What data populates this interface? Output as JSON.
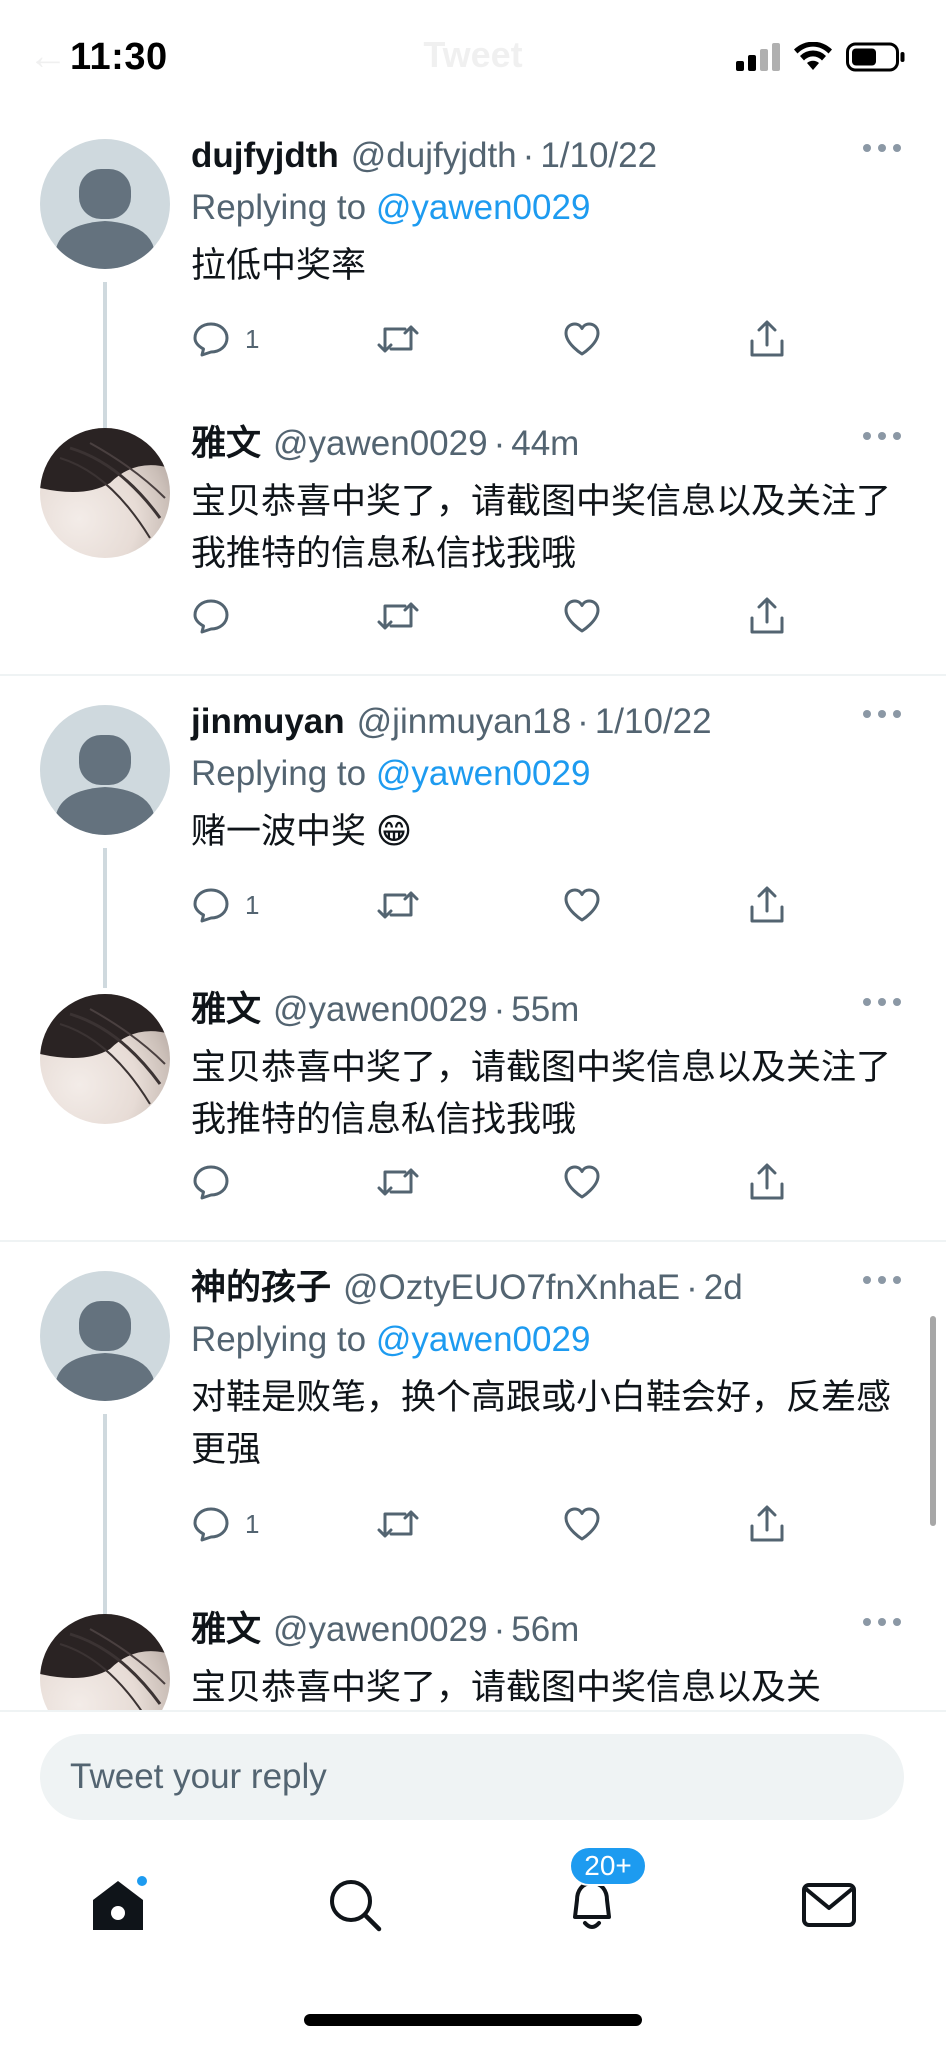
{
  "status_bar": {
    "time": "11:30"
  },
  "header": {
    "title": "Tweet"
  },
  "tweets": [
    {
      "name": "dujfyjdth",
      "handle": "@dujfyjdth",
      "time": "1/10/22",
      "replying_prefix": "Replying to",
      "replying_to": "@yawen0029",
      "text": "拉低中奖率",
      "reply_count": "1",
      "avatar": "default-avatar"
    },
    {
      "name": "雅文",
      "handle": "@yawen0029",
      "time": "44m",
      "text": "宝贝恭喜中奖了，请截图中奖信息以及关注了我推特的信息私信找我哦",
      "reply_count": "",
      "avatar": "profile-photo"
    },
    {
      "name": "jinmuyan",
      "handle": "@jinmuyan18",
      "time": "1/10/22",
      "replying_prefix": "Replying to",
      "replying_to": "@yawen0029",
      "text": "赌一波中奖 😁",
      "reply_count": "1",
      "avatar": "default-avatar"
    },
    {
      "name": "雅文",
      "handle": "@yawen0029",
      "time": "55m",
      "text": "宝贝恭喜中奖了，请截图中奖信息以及关注了我推特的信息私信找我哦",
      "reply_count": "",
      "avatar": "profile-photo"
    },
    {
      "name": "神的孩子",
      "handle": "@OztyEUO7fnXnhaE",
      "time": "2d",
      "replying_prefix": "Replying to",
      "replying_to": "@yawen0029",
      "text": "对鞋是败笔，换个高跟或小白鞋会好，反差感更强",
      "reply_count": "1",
      "avatar": "default-avatar"
    },
    {
      "name": "雅文",
      "handle": "@yawen0029",
      "time": "56m",
      "text": "宝贝恭喜中奖了，请截图中奖信息以及关",
      "reply_count": "",
      "avatar": "profile-photo"
    }
  ],
  "composer": {
    "placeholder": "Tweet your reply"
  },
  "tab_bar": {
    "items": [
      {
        "label": "Home",
        "icon": "home-icon",
        "has_dot": true
      },
      {
        "label": "Search",
        "icon": "search-icon"
      },
      {
        "label": "Notifications",
        "icon": "bell-icon",
        "badge": "20+"
      },
      {
        "label": "Messages",
        "icon": "mail-icon"
      }
    ]
  },
  "colors": {
    "accent": "#1d9bf0",
    "text": "#0f1419",
    "secondary": "#536471",
    "divider": "#eff3f4",
    "avatar_default": "#cfd9de"
  }
}
